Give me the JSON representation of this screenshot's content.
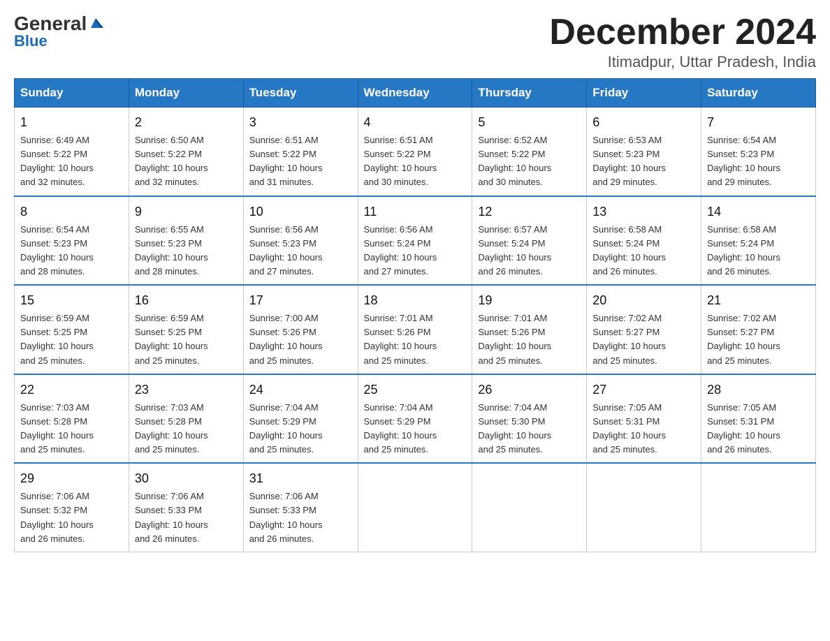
{
  "header": {
    "logo_general": "General",
    "logo_blue": "Blue",
    "month_title": "December 2024",
    "location": "Itimadpur, Uttar Pradesh, India"
  },
  "weekdays": [
    "Sunday",
    "Monday",
    "Tuesday",
    "Wednesday",
    "Thursday",
    "Friday",
    "Saturday"
  ],
  "weeks": [
    [
      {
        "day": "1",
        "sunrise": "6:49 AM",
        "sunset": "5:22 PM",
        "daylight": "10 hours and 32 minutes."
      },
      {
        "day": "2",
        "sunrise": "6:50 AM",
        "sunset": "5:22 PM",
        "daylight": "10 hours and 32 minutes."
      },
      {
        "day": "3",
        "sunrise": "6:51 AM",
        "sunset": "5:22 PM",
        "daylight": "10 hours and 31 minutes."
      },
      {
        "day": "4",
        "sunrise": "6:51 AM",
        "sunset": "5:22 PM",
        "daylight": "10 hours and 30 minutes."
      },
      {
        "day": "5",
        "sunrise": "6:52 AM",
        "sunset": "5:22 PM",
        "daylight": "10 hours and 30 minutes."
      },
      {
        "day": "6",
        "sunrise": "6:53 AM",
        "sunset": "5:23 PM",
        "daylight": "10 hours and 29 minutes."
      },
      {
        "day": "7",
        "sunrise": "6:54 AM",
        "sunset": "5:23 PM",
        "daylight": "10 hours and 29 minutes."
      }
    ],
    [
      {
        "day": "8",
        "sunrise": "6:54 AM",
        "sunset": "5:23 PM",
        "daylight": "10 hours and 28 minutes."
      },
      {
        "day": "9",
        "sunrise": "6:55 AM",
        "sunset": "5:23 PM",
        "daylight": "10 hours and 28 minutes."
      },
      {
        "day": "10",
        "sunrise": "6:56 AM",
        "sunset": "5:23 PM",
        "daylight": "10 hours and 27 minutes."
      },
      {
        "day": "11",
        "sunrise": "6:56 AM",
        "sunset": "5:24 PM",
        "daylight": "10 hours and 27 minutes."
      },
      {
        "day": "12",
        "sunrise": "6:57 AM",
        "sunset": "5:24 PM",
        "daylight": "10 hours and 26 minutes."
      },
      {
        "day": "13",
        "sunrise": "6:58 AM",
        "sunset": "5:24 PM",
        "daylight": "10 hours and 26 minutes."
      },
      {
        "day": "14",
        "sunrise": "6:58 AM",
        "sunset": "5:24 PM",
        "daylight": "10 hours and 26 minutes."
      }
    ],
    [
      {
        "day": "15",
        "sunrise": "6:59 AM",
        "sunset": "5:25 PM",
        "daylight": "10 hours and 25 minutes."
      },
      {
        "day": "16",
        "sunrise": "6:59 AM",
        "sunset": "5:25 PM",
        "daylight": "10 hours and 25 minutes."
      },
      {
        "day": "17",
        "sunrise": "7:00 AM",
        "sunset": "5:26 PM",
        "daylight": "10 hours and 25 minutes."
      },
      {
        "day": "18",
        "sunrise": "7:01 AM",
        "sunset": "5:26 PM",
        "daylight": "10 hours and 25 minutes."
      },
      {
        "day": "19",
        "sunrise": "7:01 AM",
        "sunset": "5:26 PM",
        "daylight": "10 hours and 25 minutes."
      },
      {
        "day": "20",
        "sunrise": "7:02 AM",
        "sunset": "5:27 PM",
        "daylight": "10 hours and 25 minutes."
      },
      {
        "day": "21",
        "sunrise": "7:02 AM",
        "sunset": "5:27 PM",
        "daylight": "10 hours and 25 minutes."
      }
    ],
    [
      {
        "day": "22",
        "sunrise": "7:03 AM",
        "sunset": "5:28 PM",
        "daylight": "10 hours and 25 minutes."
      },
      {
        "day": "23",
        "sunrise": "7:03 AM",
        "sunset": "5:28 PM",
        "daylight": "10 hours and 25 minutes."
      },
      {
        "day": "24",
        "sunrise": "7:04 AM",
        "sunset": "5:29 PM",
        "daylight": "10 hours and 25 minutes."
      },
      {
        "day": "25",
        "sunrise": "7:04 AM",
        "sunset": "5:29 PM",
        "daylight": "10 hours and 25 minutes."
      },
      {
        "day": "26",
        "sunrise": "7:04 AM",
        "sunset": "5:30 PM",
        "daylight": "10 hours and 25 minutes."
      },
      {
        "day": "27",
        "sunrise": "7:05 AM",
        "sunset": "5:31 PM",
        "daylight": "10 hours and 25 minutes."
      },
      {
        "day": "28",
        "sunrise": "7:05 AM",
        "sunset": "5:31 PM",
        "daylight": "10 hours and 26 minutes."
      }
    ],
    [
      {
        "day": "29",
        "sunrise": "7:06 AM",
        "sunset": "5:32 PM",
        "daylight": "10 hours and 26 minutes."
      },
      {
        "day": "30",
        "sunrise": "7:06 AM",
        "sunset": "5:33 PM",
        "daylight": "10 hours and 26 minutes."
      },
      {
        "day": "31",
        "sunrise": "7:06 AM",
        "sunset": "5:33 PM",
        "daylight": "10 hours and 26 minutes."
      },
      null,
      null,
      null,
      null
    ]
  ],
  "labels": {
    "sunrise": "Sunrise: ",
    "sunset": "Sunset: ",
    "daylight": "Daylight: "
  }
}
